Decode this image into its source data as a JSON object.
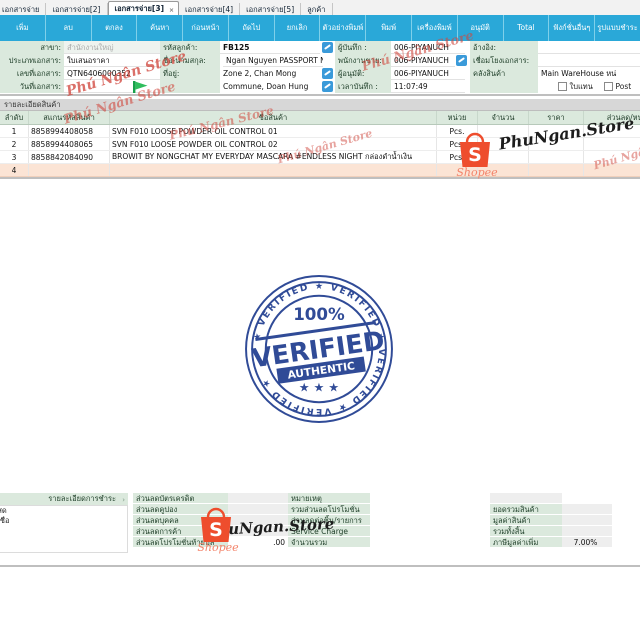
{
  "tabs": [
    {
      "label": "เอกสารจ่าย",
      "active": false,
      "closable": false
    },
    {
      "label": "เอกสารจ่าย[2]",
      "active": false,
      "closable": false
    },
    {
      "label": "เอกสารจ่าย[3]",
      "active": true,
      "closable": true,
      "close_glyph": "×"
    },
    {
      "label": "เอกสารจ่าย[4]",
      "active": false,
      "closable": false
    },
    {
      "label": "เอกสารจ่าย[5]",
      "active": false,
      "closable": false
    },
    {
      "label": "ลูกค้า",
      "active": false,
      "closable": false
    }
  ],
  "toolbar": {
    "accent_color": "#2aa8d8",
    "buttons": [
      {
        "label": "เพิ่ม"
      },
      {
        "label": "ลบ"
      },
      {
        "label": "ตกลง"
      },
      {
        "label": "ค้นหา"
      },
      {
        "label": "ก่อนหน้า"
      },
      {
        "label": "ถัดไป"
      },
      {
        "label": "ยกเลิก"
      },
      {
        "label": "ตัวอย่างพิมพ์"
      },
      {
        "label": "พิมพ์"
      },
      {
        "label": "เครื่องพิมพ์"
      },
      {
        "label": "อนุมัติ"
      },
      {
        "label": "Total"
      },
      {
        "label": "ฟังก์ชั่นอื่นๆ"
      },
      {
        "label": "รูปแบบชำระ"
      }
    ]
  },
  "header": {
    "branch_label": "สาขา:",
    "branch_value": "สำนักงานใหญ่",
    "doctype_label": "ประเภทเอกสาร:",
    "doctype_value": "ใบเสนอราคา",
    "docno_label": "เลขที่เอกสาร:",
    "docno_value": "QTN6406000352",
    "docdate_label": "วันที่เอกสาร:",
    "docdate_value": "",
    "custcode_label": "รหัสลูกค้า:",
    "custcode_value": "FB125",
    "custname_label": "ชื่อ-นามสกุล:",
    "custname_value": "Ngan Nguyen PASSPORT N",
    "address_label": "ที่อยู่:",
    "address_value_line1": "Zone 2, Chan Mong",
    "address_value_line2": "Commune, Doan Hung",
    "recorder_label": "ผู้บันทึก :",
    "recorder_value": "006-PIYANUCH",
    "salesman_label": "พนักงานขาย:",
    "salesman_value": "006-PIYANUCH",
    "approver_label": "ผู้อนุมัติ:",
    "approver_value": "006-PIYANUCH",
    "rectime_label": "เวลาบันทึก :",
    "rectime_value": "11:07:49",
    "reference_label": "อ้างอิง:",
    "reference_value": "",
    "linkdoc_label": "เชื่อมโยงเอกสาร:",
    "linkdoc_value": "",
    "warehouse_label": "คลังสินค้า",
    "warehouse_value": "Main WareHouse หน่",
    "chk_substitute_label": "ใบแทน",
    "chk_post_label": "Post"
  },
  "detail": {
    "section_title": "รายละเอียดสินค้า",
    "columns": [
      "ลำดับ",
      "สแกนรหัสสินค้า",
      "ชื่อสินค้า",
      "หน่วย",
      "จำนวน",
      "ราคา",
      "ส่วนลด/หน่วย"
    ],
    "rows": [
      {
        "no": "1",
        "code": "8858994408058",
        "name": "SVN F010 LOOSE POWDER OIL CONTROL 01",
        "unit": "Pcs.",
        "qty": "",
        "price": "",
        "disc": ""
      },
      {
        "no": "2",
        "code": "8858994408065",
        "name": "SVN F010 LOOSE POWDER OIL CONTROL 02",
        "unit": "Pcs.",
        "qty": "",
        "price": "",
        "disc": ""
      },
      {
        "no": "3",
        "code": "8858842084090",
        "name": "BROWIT BY NONGCHAT MY EVERYDAY MASCARA #ENDLESS NIGHT กล่องดำน้ำเงิน",
        "unit": "Pcs.",
        "qty": "",
        "price": "",
        "disc": ""
      },
      {
        "no": "4",
        "code": "",
        "name": "",
        "unit": "",
        "qty": "",
        "price": "",
        "disc": ""
      }
    ]
  },
  "footer": {
    "payment_title": "รายละเอียดการชำระ",
    "payment_arrow": "›",
    "payment_items": [
      "เงินสด",
      "เงินเชื่อ"
    ],
    "discount_labels": [
      "ส่วนลดบัตรเครดิต",
      "ส่วนลดคูปอง",
      "ส่วนลดบุคคล",
      "ส่วนลดการค้า",
      "ส่วนลดโปรโมชั่นท้ายบิล"
    ],
    "discount_values": [
      "",
      "",
      "",
      "",
      ".00"
    ],
    "middle_labels": [
      "หมายเหตุ",
      "รวมส่วนลดโปรโมชั่น",
      "ส่วนลดต่อชิ้น/รายการ",
      "Service Charge",
      "จำนวนรวม"
    ],
    "middle_values": [
      "",
      "",
      "",
      "",
      ""
    ],
    "total_labels": [
      "",
      "ยอดรวมสินค้า",
      "มูลค่าสินค้า",
      "รวมทั้งสิ้น",
      "ภาษีมูลค่าเพิ่ม"
    ],
    "total_values": [
      "",
      "",
      "",
      "",
      "7.00%"
    ]
  },
  "watermarks": {
    "brand_text": "PhuNgan.Store",
    "red_text": "Phú Ngân Store",
    "shopee_word": "Shopee",
    "shopee_color": "#ee4d2d",
    "stamp": {
      "percent": "100%",
      "main": "VERIFIED",
      "sub": "AUTHENTIC",
      "ring": "VERIFIED",
      "color": "#1f3c8f"
    }
  }
}
